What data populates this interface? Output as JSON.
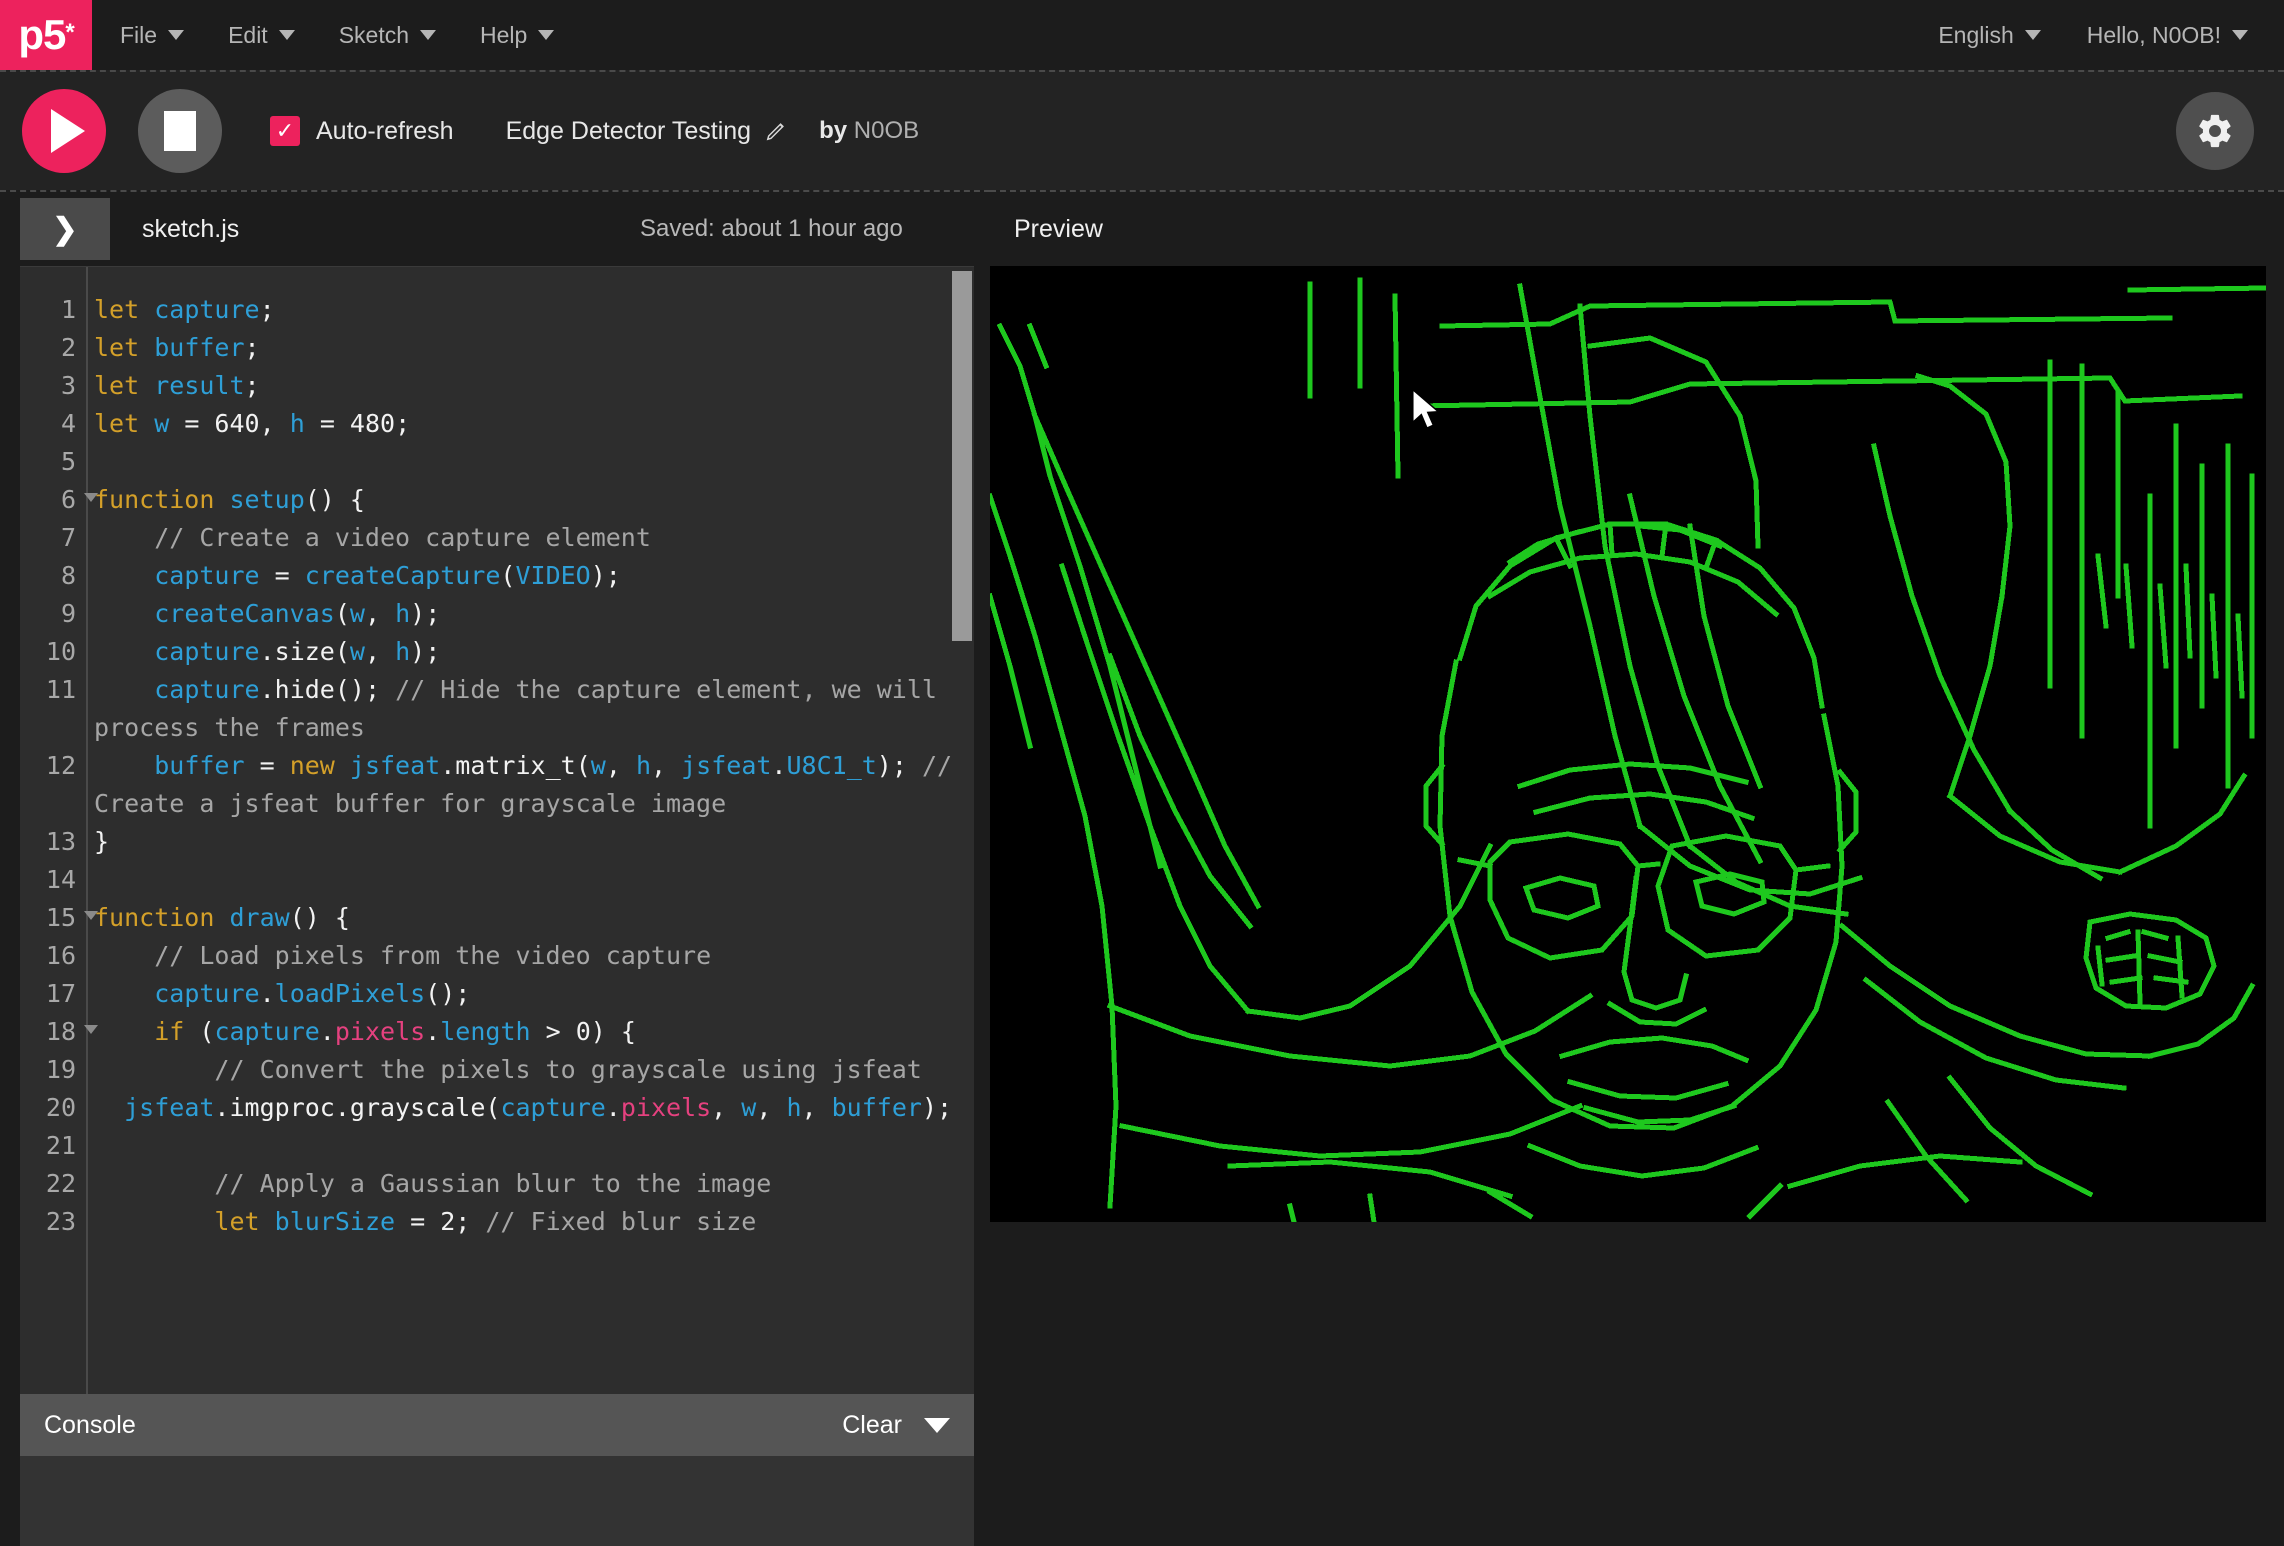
{
  "nav": {
    "logo_text": "p5",
    "logo_star": "*",
    "menu": [
      {
        "label": "File",
        "icon": "chevron-down-icon"
      },
      {
        "label": "Edit",
        "icon": "chevron-down-icon"
      },
      {
        "label": "Sketch",
        "icon": "chevron-down-icon"
      },
      {
        "label": "Help",
        "icon": "chevron-down-icon"
      }
    ],
    "language": "English",
    "account": "Hello, N0OB!"
  },
  "toolbar": {
    "play_label": "play-button",
    "stop_label": "stop-button",
    "autorefresh_label": "Auto-refresh",
    "autorefresh_checked": true,
    "check_glyph": "✓",
    "sketch_title": "Edge Detector Testing",
    "by_prefix": "by",
    "author": "N0OB",
    "settings_label": "settings"
  },
  "editor": {
    "toggle_glyph": "❯",
    "filename": "sketch.js",
    "saved_status": "Saved: about 1 hour ago",
    "line_numbers": [
      "1",
      "2",
      "3",
      "4",
      "5",
      "6",
      "7",
      "8",
      "9",
      "10",
      "11",
      "12",
      "13",
      "14",
      "15",
      "16",
      "17",
      "18",
      "19",
      "20",
      "21",
      "22",
      "23"
    ],
    "fold_lines": [
      "6",
      "15",
      "18"
    ],
    "code_lines": [
      "let capture;",
      "let buffer;",
      "let result;",
      "let w = 640, h = 480;",
      "",
      "function setup() {",
      "    // Create a video capture element",
      "    capture = createCapture(VIDEO);",
      "    createCanvas(w, h);",
      "    capture.size(w, h);",
      "    capture.hide(); // Hide the capture element, we will process the frames",
      "    buffer = new jsfeat.matrix_t(w, h, jsfeat.U8C1_t); // Create a jsfeat buffer for grayscale image",
      "}",
      "",
      "function draw() {",
      "    // Load pixels from the video capture",
      "    capture.loadPixels();",
      "    if (capture.pixels.length > 0) {",
      "        // Convert the pixels to grayscale using jsfeat",
      "  jsfeat.imgproc.grayscale(capture.pixels, w, h, buffer);",
      "",
      "        // Apply a Gaussian blur to the image",
      "        let blurSize = 2; // Fixed blur size"
    ]
  },
  "console": {
    "title": "Console",
    "clear_label": "Clear",
    "collapse_icon": "chevron-down-icon"
  },
  "preview": {
    "label": "Preview",
    "canvas_background": "#000000",
    "edge_color": "#1ec81e",
    "cursor_icon": "mouse-pointer-icon"
  },
  "colors": {
    "brand_pink": "#ed225d",
    "nav_bg": "#1c1c1c",
    "toolbar_bg": "#232323",
    "editor_bg": "#2d2d2d",
    "console_bar_bg": "#555555",
    "syntax_keyword": "#d4a029",
    "syntax_function": "#2e9fd7",
    "syntax_comment": "#a6a6a6",
    "syntax_property": "#e5417f",
    "syntax_plain": "#f2f2f2"
  }
}
